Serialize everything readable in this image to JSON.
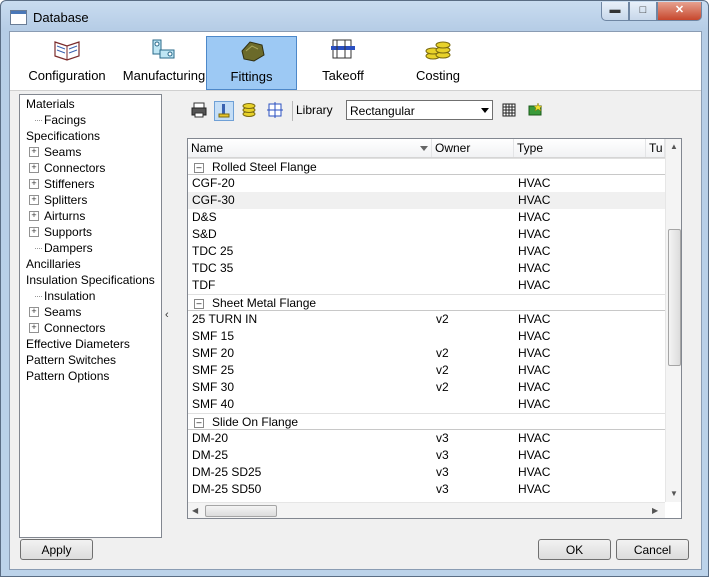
{
  "window": {
    "title": "Database"
  },
  "tabs": [
    {
      "label": "Configuration",
      "icon": "book-icon"
    },
    {
      "label": "Manufacturing",
      "icon": "machine-icon"
    },
    {
      "label": "Fittings",
      "icon": "fittings-icon",
      "active": true
    },
    {
      "label": "Takeoff",
      "icon": "takeoff-icon"
    },
    {
      "label": "Costing",
      "icon": "coins-icon"
    }
  ],
  "tree": [
    {
      "label": "Materials"
    },
    {
      "label": "Facings"
    },
    {
      "label": "Specifications"
    },
    {
      "label": "Seams"
    },
    {
      "label": "Connectors"
    },
    {
      "label": "Stiffeners"
    },
    {
      "label": "Splitters"
    },
    {
      "label": "Airturns"
    },
    {
      "label": "Supports"
    },
    {
      "label": "Dampers"
    },
    {
      "label": "Ancillaries"
    },
    {
      "label": "Insulation Specifications"
    },
    {
      "label": "Insulation"
    },
    {
      "label": "Seams"
    },
    {
      "label": "Connectors"
    },
    {
      "label": "Effective Diameters"
    },
    {
      "label": "Pattern Switches"
    },
    {
      "label": "Pattern Options"
    }
  ],
  "toolbar": {
    "library_label": "Library",
    "library_value": "Rectangular"
  },
  "grid": {
    "columns": [
      "Name",
      "Owner",
      "Type",
      "Tu"
    ],
    "groups": [
      {
        "title": "Rolled Steel Flange",
        "rows": [
          {
            "name": "CGF-20",
            "owner": "",
            "type": "HVAC"
          },
          {
            "name": "CGF-30",
            "owner": "",
            "type": "HVAC"
          },
          {
            "name": "D&S",
            "owner": "",
            "type": "HVAC"
          },
          {
            "name": "S&D",
            "owner": "",
            "type": "HVAC"
          },
          {
            "name": "TDC 25",
            "owner": "",
            "type": "HVAC"
          },
          {
            "name": "TDC 35",
            "owner": "",
            "type": "HVAC"
          },
          {
            "name": "TDF",
            "owner": "",
            "type": "HVAC"
          }
        ]
      },
      {
        "title": "Sheet Metal Flange",
        "rows": [
          {
            "name": "25 TURN IN",
            "owner": "v2",
            "type": "HVAC"
          },
          {
            "name": "SMF 15",
            "owner": "",
            "type": "HVAC"
          },
          {
            "name": "SMF 20",
            "owner": "v2",
            "type": "HVAC"
          },
          {
            "name": "SMF 25",
            "owner": "v2",
            "type": "HVAC"
          },
          {
            "name": "SMF 30",
            "owner": "v2",
            "type": "HVAC"
          },
          {
            "name": "SMF 40",
            "owner": "",
            "type": "HVAC"
          }
        ]
      },
      {
        "title": "Slide On Flange",
        "rows": [
          {
            "name": "DM-20",
            "owner": "v3",
            "type": "HVAC"
          },
          {
            "name": "DM-25",
            "owner": "v3",
            "type": "HVAC"
          },
          {
            "name": "DM-25 SD25",
            "owner": "v3",
            "type": "HVAC"
          },
          {
            "name": "DM-25 SD50",
            "owner": "v3",
            "type": "HVAC"
          }
        ]
      }
    ]
  },
  "buttons": {
    "apply": "Apply",
    "ok": "OK",
    "cancel": "Cancel"
  }
}
